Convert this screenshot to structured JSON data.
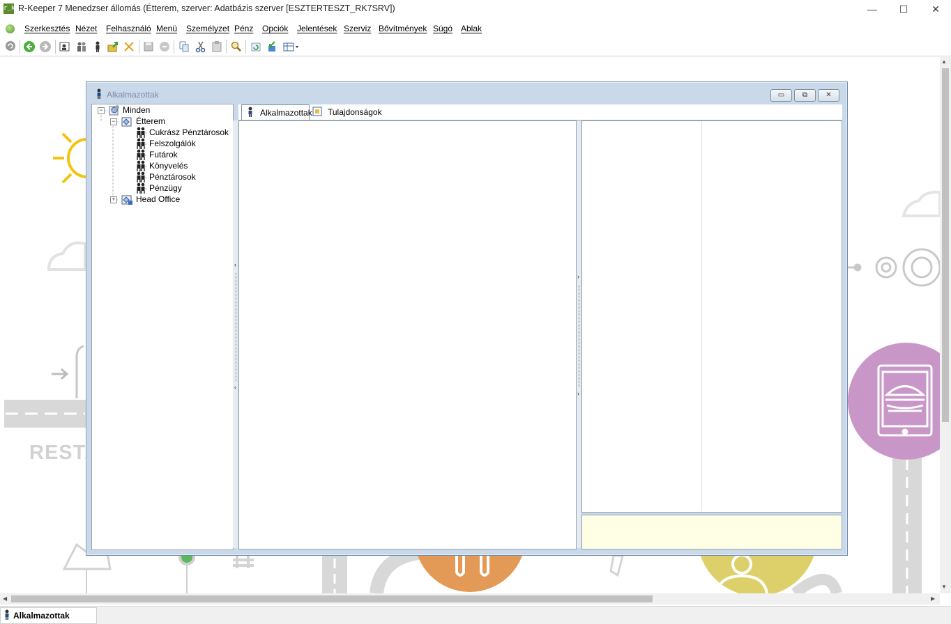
{
  "window": {
    "title": "R-Keeper 7 Menedzser állomás (Étterem, szerver: Adatbázis szerver [ESZTERTESZT_RK7SRV])",
    "app_icon_text": "r_k",
    "minimize": "—",
    "maximize": "☐",
    "close": "✕"
  },
  "menu": {
    "items": [
      "Szerkesztés",
      "Nézet",
      "Felhasználó",
      "Menü",
      "Személyzet",
      "Pénz",
      "Opciók",
      "Jelentések",
      "Szerviz",
      "Bővítmények",
      "Súgó",
      "Ablak"
    ]
  },
  "toolbar": {
    "icons": [
      "refresh-icon",
      "back-icon",
      "forward-icon",
      "employee-card-icon",
      "group-icon",
      "person-icon",
      "export-icon",
      "delete-icon",
      "save-icon",
      "cancel-icon",
      "copy-icon",
      "cut-icon",
      "paste-icon",
      "search-icon",
      "reload-icon",
      "import-icon",
      "view-icon"
    ]
  },
  "background": {
    "restaurant_text": "RESTA"
  },
  "child_window": {
    "title": "Alkalmazottak",
    "min_btn": "▭",
    "restore_btn": "⧉",
    "close_btn": "✕"
  },
  "tree": {
    "root": "Minden",
    "restaurant": "Étterem",
    "groups": [
      "Cukrász Pénztárosok",
      "Felszolgálók",
      "Futárok",
      "Könyvelés",
      "Pénztárosok",
      "Pénzügy"
    ],
    "head_office": "Head Office"
  },
  "tabs": {
    "employees": "Alkalmazottak",
    "properties": "Tulajdonságok"
  },
  "status": {
    "label": "Alkalmazottak"
  },
  "colors": {
    "accent_yellow": "#f2c40f",
    "purple_circle": "#c996c8",
    "orange_circle": "#e39a56",
    "yellow_circle": "#ddd06a",
    "desc_bg": "#ffffe6"
  }
}
